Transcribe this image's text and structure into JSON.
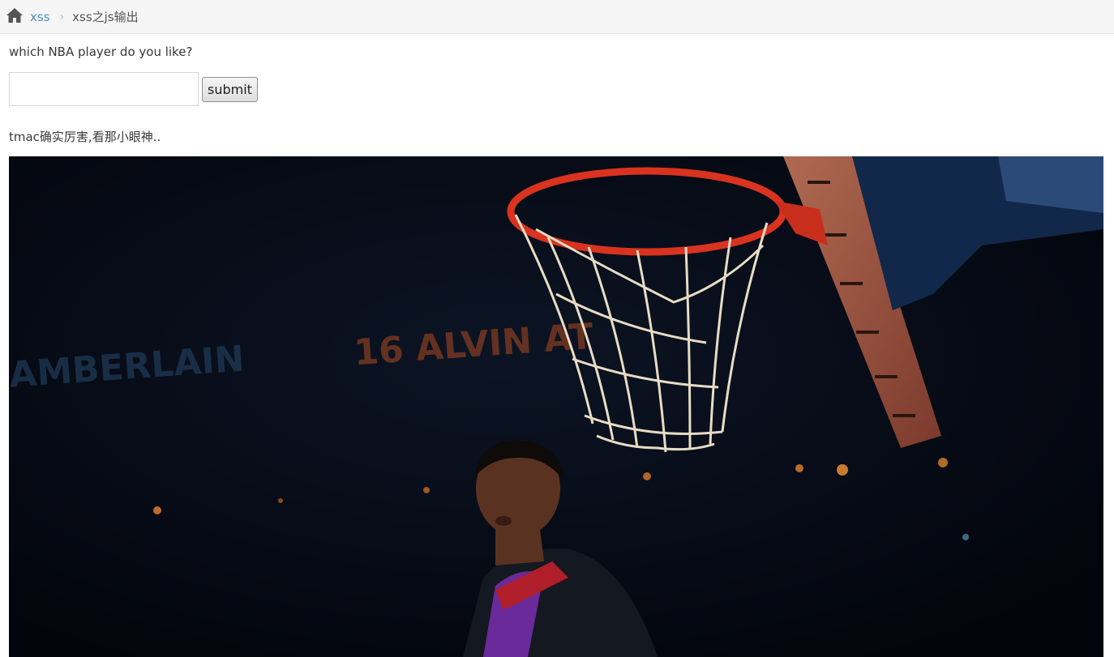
{
  "breadcrumb": {
    "home_icon": "home-icon",
    "link_label": "xss",
    "separator": "›",
    "current_label": "xss之js输出"
  },
  "form": {
    "question": "which NBA player do you like?",
    "input_value": "",
    "submit_label": "submit"
  },
  "result": {
    "message": "tmac确实厉害,看那小眼神..",
    "image_subject": "basketball player under hoop",
    "arena_text_left": "AMBERLAIN",
    "arena_text_center": "16 ALVIN AT"
  },
  "colors": {
    "link": "#4c8fbd",
    "breadcrumb_bg": "#f5f5f5",
    "rim": "#d9331f",
    "jersey": "#6a2a9a"
  }
}
